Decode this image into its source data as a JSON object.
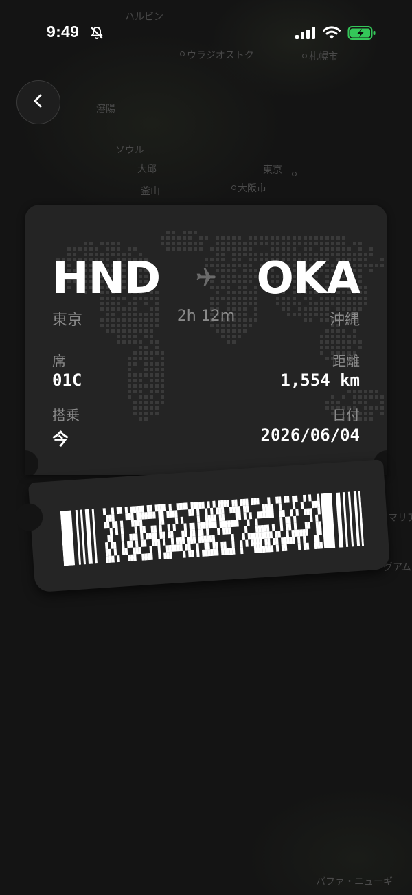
{
  "status_bar": {
    "time": "9:49",
    "icons": [
      "bell-slash-icon",
      "signal-icon",
      "wifi-icon",
      "battery-charging-icon"
    ],
    "battery_color": "#34c759"
  },
  "map": {
    "labels": [
      "ハルビン",
      "ウラジオストク",
      "札幌市",
      "瀋陽",
      "ソウル",
      "大邱",
      "釜山",
      "東京",
      "大阪市",
      "マリア",
      "グアム",
      "バファ・ニューギ"
    ]
  },
  "navigation": {
    "back_icon": "chevron-left-icon"
  },
  "ticket": {
    "origin_code": "HND",
    "origin_city": "東京",
    "destination_code": "OKA",
    "destination_city": "沖縄",
    "duration": "2h 12m",
    "plane_icon": "airplane-icon",
    "seat_label": "席",
    "seat_value": "01C",
    "distance_label": "距離",
    "distance_value": "1,554 km",
    "boarding_label": "搭乗",
    "boarding_value": "今",
    "date_label": "日付",
    "date_value": "2026/06/04",
    "barcode_icon": "pdf417-barcode-icon"
  }
}
